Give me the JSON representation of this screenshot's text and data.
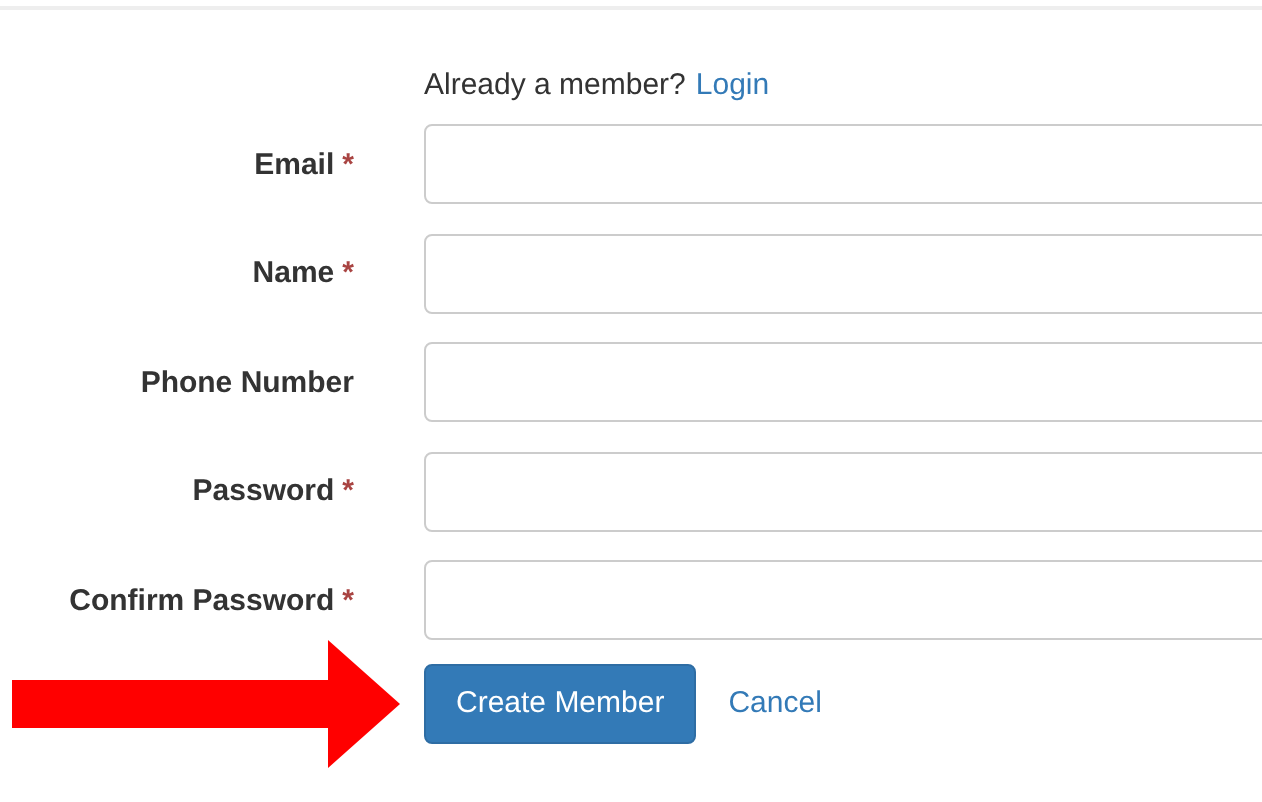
{
  "login_prompt": {
    "text": "Already a member?",
    "link": "Login"
  },
  "fields": [
    {
      "label": "Email",
      "required_mark": "*"
    },
    {
      "label": "Name",
      "required_mark": "*"
    },
    {
      "label": "Phone Number"
    },
    {
      "label": "Password",
      "required_mark": "*"
    },
    {
      "label": "Confirm Password",
      "required_mark": "*"
    }
  ],
  "buttons": [
    {
      "label": "Create Member",
      "kind": "primary"
    },
    {
      "label": "Cancel",
      "kind": "link"
    }
  ]
}
